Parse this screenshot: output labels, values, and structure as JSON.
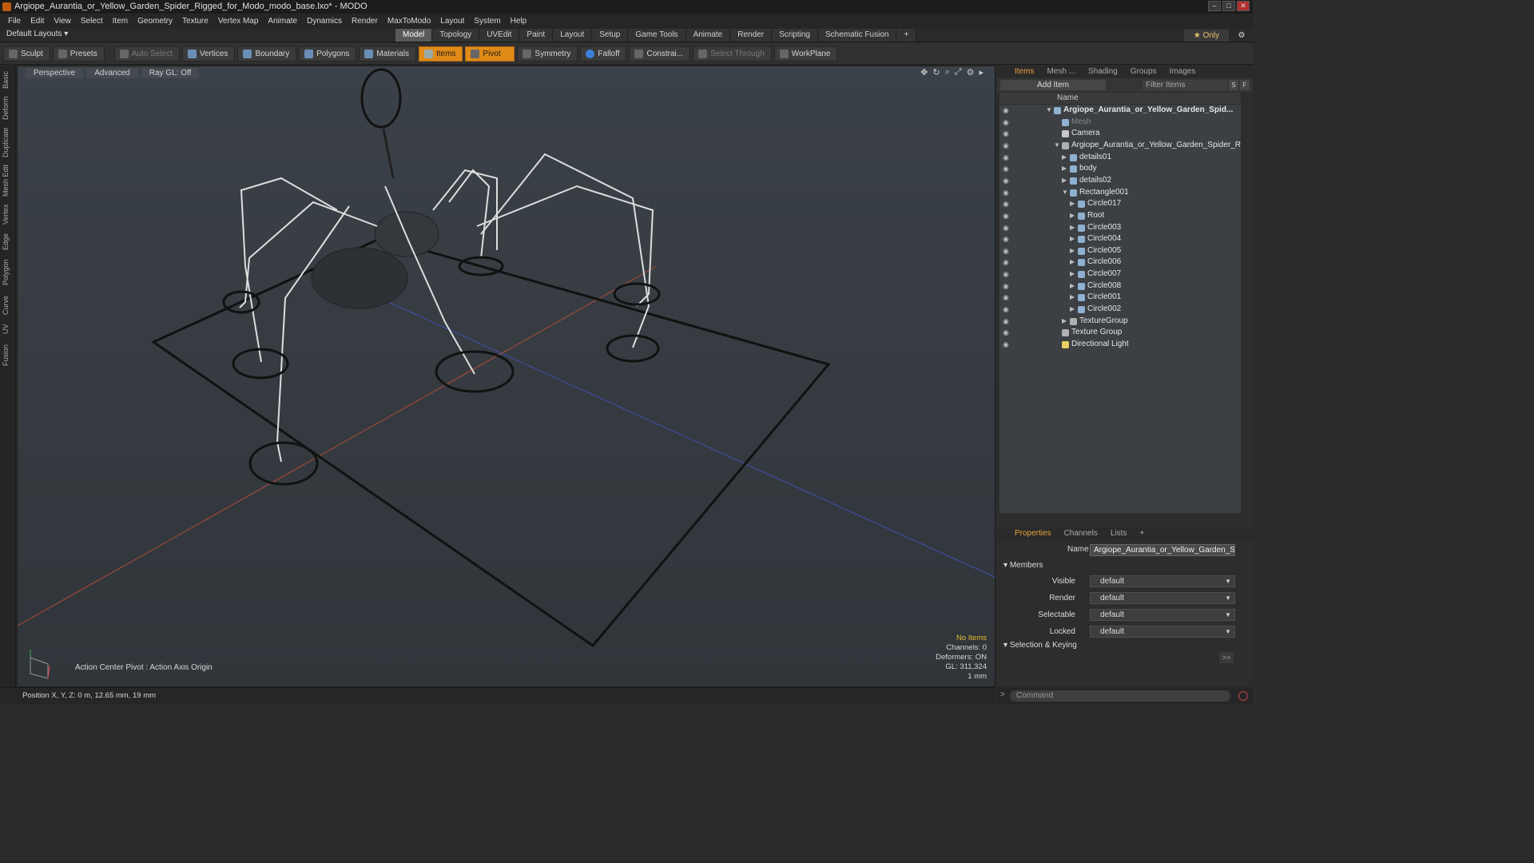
{
  "window": {
    "title": "Argiope_Aurantia_or_Yellow_Garden_Spider_Rigged_for_Modo_modo_base.lxo* - MODO"
  },
  "menu": [
    "File",
    "Edit",
    "View",
    "Select",
    "Item",
    "Geometry",
    "Texture",
    "Vertex Map",
    "Animate",
    "Dynamics",
    "Render",
    "MaxToModo",
    "Layout",
    "System",
    "Help"
  ],
  "layouts_label": "Default Layouts ▾",
  "mode_tabs": [
    "Model",
    "Topology",
    "UVEdit",
    "Paint",
    "Layout",
    "Setup",
    "Game Tools",
    "Animate",
    "Render",
    "Scripting",
    "Schematic Fusion",
    "+"
  ],
  "only_label": "★ Only",
  "toolbar": {
    "sculpt": "Sculpt",
    "presets": "Presets",
    "auto_select": "Auto Select",
    "vertices": "Vertices",
    "boundary": "Boundary",
    "polygons": "Polygons",
    "materials": "Materials",
    "items": "Items",
    "pivot": "Pivot",
    "symmetry": "Symmetry",
    "falloff": "Falloff",
    "constraints": "Constrai...",
    "select_through": "Select Through",
    "workplane": "WorkPlane"
  },
  "left_tabs": [
    "Basic",
    "Deform",
    "Duplicate",
    "Mesh Edit",
    "Vertex",
    "Edge",
    "Polygon",
    "Curve",
    "UV",
    "Fusion"
  ],
  "viewport": {
    "perspective": "Perspective",
    "advanced": "Advanced",
    "raygl": "Ray GL: Off",
    "action_center": "Action Center Pivot : Action Axis Origin",
    "info": {
      "no_items": "No Items",
      "channels": "Channels: 0",
      "deformers": "Deformers: ON",
      "gl": "GL: 311,324",
      "scale": "1 mm"
    }
  },
  "status": "Position X, Y, Z:  0 m, 12.65 mm, 19 mm",
  "items_panel": {
    "tabs": [
      "Items",
      "Mesh ...",
      "Shading",
      "Groups",
      "Images"
    ],
    "add_item": "Add Item",
    "filter": "Filter Items",
    "s_btn": "S",
    "f_btn": "F",
    "name_col": "Name",
    "tree": [
      {
        "name": "Argiope_Aurantia_or_Yellow_Garden_Spid...",
        "depth": 0,
        "type": "scene"
      },
      {
        "name": "Mesh",
        "depth": 1,
        "type": "mesh"
      },
      {
        "name": "Camera",
        "depth": 1,
        "type": "camera"
      },
      {
        "name": "Argiope_Aurantia_or_Yellow_Garden_Spider_Ri...",
        "depth": 1,
        "type": "group"
      },
      {
        "name": "details01",
        "depth": 2,
        "type": "mesh"
      },
      {
        "name": "body",
        "depth": 2,
        "type": "mesh"
      },
      {
        "name": "details02",
        "depth": 2,
        "type": "mesh"
      },
      {
        "name": "Rectangle001",
        "depth": 2,
        "type": "mesh"
      },
      {
        "name": "Circle017",
        "depth": 3,
        "type": "mesh"
      },
      {
        "name": "Root",
        "depth": 3,
        "type": "locator"
      },
      {
        "name": "Circle003",
        "depth": 3,
        "type": "mesh"
      },
      {
        "name": "Circle004",
        "depth": 3,
        "type": "mesh"
      },
      {
        "name": "Circle005",
        "depth": 3,
        "type": "mesh"
      },
      {
        "name": "Circle006",
        "depth": 3,
        "type": "mesh"
      },
      {
        "name": "Circle007",
        "depth": 3,
        "type": "mesh"
      },
      {
        "name": "Circle008",
        "depth": 3,
        "type": "mesh"
      },
      {
        "name": "Circle001",
        "depth": 3,
        "type": "mesh"
      },
      {
        "name": "Circle002",
        "depth": 3,
        "type": "mesh"
      },
      {
        "name": "TextureGroup",
        "depth": 2,
        "type": "group"
      },
      {
        "name": "Texture Group",
        "depth": 1,
        "type": "group"
      },
      {
        "name": "Directional Light",
        "depth": 1,
        "type": "light"
      }
    ]
  },
  "props_panel": {
    "tabs": [
      "Properties",
      "Channels",
      "Lists",
      "+"
    ],
    "name_label": "Name",
    "name_value": "Argiope_Aurantia_or_Yellow_Garden_Spider",
    "members": "Members",
    "rows": [
      {
        "label": "Visible",
        "value": "default"
      },
      {
        "label": "Render",
        "value": "default"
      },
      {
        "label": "Selectable",
        "value": "default"
      },
      {
        "label": "Locked",
        "value": "default"
      }
    ],
    "selection_keying": "Selection & Keying",
    "more": ">>",
    "command_placeholder": "Command"
  },
  "colors": {
    "accent": "#e08a18",
    "tab_active": "#e8a23a",
    "warning": "#e8b830"
  }
}
